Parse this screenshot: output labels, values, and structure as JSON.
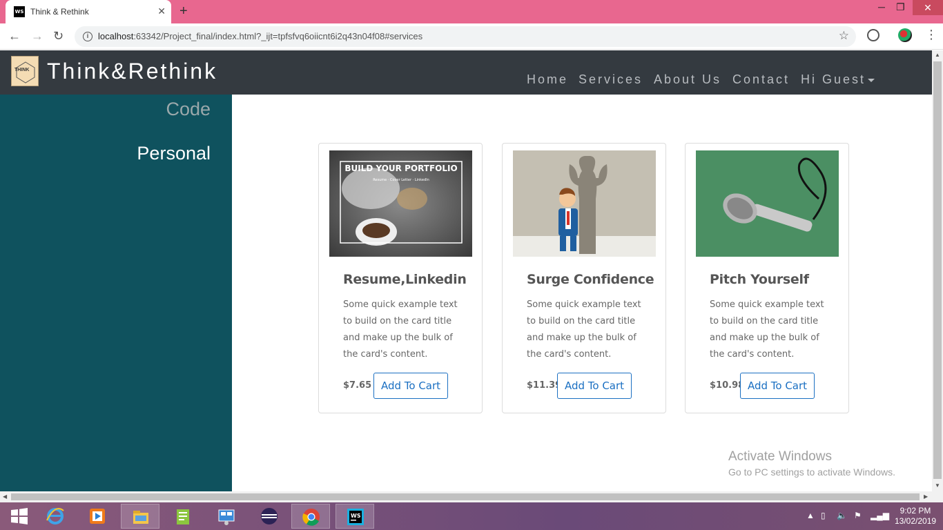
{
  "browser": {
    "tab_title": "Think & Rethink",
    "tab_favicon": "WS",
    "url_host": "localhost",
    "url_rest": ":63342/Project_final/index.html?_ijt=tpfsfvq6oiicnt6i2q43n04f08#services"
  },
  "site": {
    "brand": "Think&Rethink",
    "logo_text": "THINK",
    "nav": {
      "home": "Home",
      "services": "Services",
      "about": "About Us",
      "contact": "Contact",
      "user": "Hi Guest"
    }
  },
  "sidebar": {
    "items": [
      {
        "label": "Code"
      },
      {
        "label": "Personal"
      }
    ]
  },
  "cards": [
    {
      "title": "Resume,Linkedin",
      "text": "Some quick example text to build on the card title and make up the bulk of the card's content.",
      "price": "$7.65",
      "button": "Add To Cart",
      "image_banner": "BUILD YOUR PORTFOLIO",
      "image_sub": "Resume · Cover Letter · LinkedIn"
    },
    {
      "title": "Surge Confidence",
      "text": "Some quick example text to build on the card title and make up the bulk of the card's content.",
      "price": "$11.39",
      "button": "Add To Cart"
    },
    {
      "title": "Pitch Yourself",
      "text": "Some quick example text to build on the card title and make up the bulk of the card's content.",
      "price": "$10.98",
      "button": "Add To Cart"
    }
  ],
  "watermark": {
    "line1": "Activate Windows",
    "line2": "Go to PC settings to activate Windows."
  },
  "taskbar": {
    "time": "9:02 PM",
    "date": "13/02/2019",
    "items": [
      "start-icon",
      "internet-explorer-icon",
      "media-player-icon",
      "file-explorer-icon",
      "notepad-icon",
      "control-panel-icon",
      "eclipse-icon",
      "chrome-icon",
      "webstorm-icon"
    ]
  },
  "colors": {
    "titlebar": "#e8678f",
    "header": "#343a40",
    "sidebar": "#0f525e",
    "button": "#1a6fc2"
  }
}
